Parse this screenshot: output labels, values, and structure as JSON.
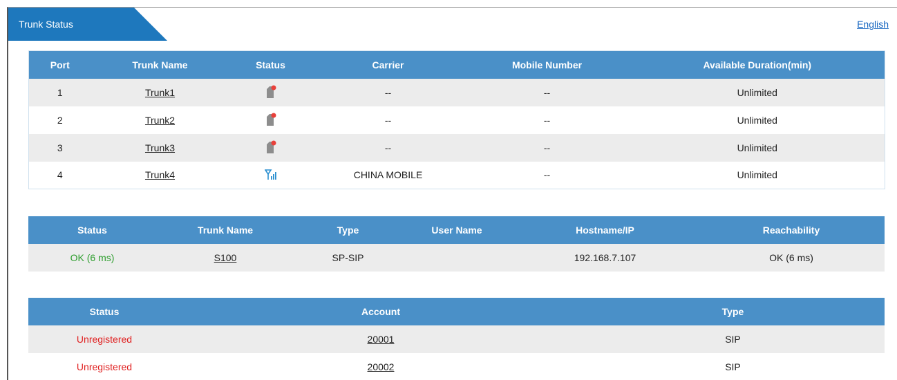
{
  "header": {
    "tab_title": "Trunk Status",
    "language_link": "English"
  },
  "gsm_trunks": {
    "columns": [
      "Port",
      "Trunk Name",
      "Status",
      "Carrier",
      "Mobile Number",
      "Available Duration(min)"
    ],
    "rows": [
      {
        "port": "1",
        "name": "Trunk1",
        "status_icon": "sim-error-icon",
        "carrier": "--",
        "mobile": "--",
        "duration": "Unlimited"
      },
      {
        "port": "2",
        "name": "Trunk2",
        "status_icon": "sim-error-icon",
        "carrier": "--",
        "mobile": "--",
        "duration": "Unlimited"
      },
      {
        "port": "3",
        "name": "Trunk3",
        "status_icon": "sim-error-icon",
        "carrier": "--",
        "mobile": "--",
        "duration": "Unlimited"
      },
      {
        "port": "4",
        "name": "Trunk4",
        "status_icon": "signal-icon",
        "carrier": "CHINA MOBILE",
        "mobile": "--",
        "duration": "Unlimited"
      }
    ]
  },
  "sip_trunks": {
    "columns": [
      "Status",
      "Trunk Name",
      "Type",
      "User Name",
      "Hostname/IP",
      "Reachability"
    ],
    "rows": [
      {
        "status": "OK (6 ms)",
        "name": "S100",
        "type": "SP-SIP",
        "user": "",
        "host": "192.168.7.107",
        "reach": "OK (6 ms)"
      }
    ]
  },
  "accounts": {
    "columns": [
      "Status",
      "Account",
      "Type"
    ],
    "rows": [
      {
        "status": "Unregistered",
        "account": "20001",
        "type": "SIP"
      },
      {
        "status": "Unregistered",
        "account": "20002",
        "type": "SIP"
      }
    ]
  },
  "colors": {
    "header_blue": "#4a90c8",
    "tab_blue": "#1e78bd",
    "ok_green": "#2e9e2e",
    "error_red": "#e02020",
    "link_blue": "#1565c0"
  }
}
